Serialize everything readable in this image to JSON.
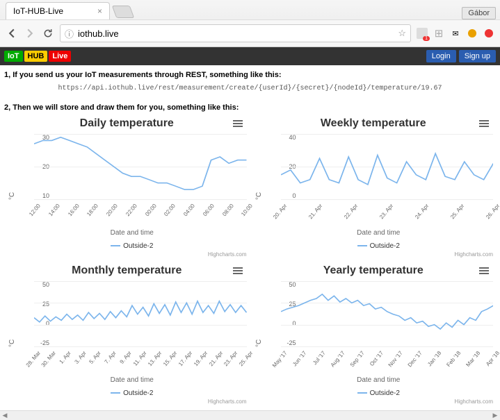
{
  "browser": {
    "tab_title": "IoT-HUB-Live",
    "profile": "Gábor",
    "url": "iothub.live"
  },
  "logo": {
    "iot": "IoT",
    "hub": "HUB",
    "live": "Live"
  },
  "auth": {
    "login": "Login",
    "signup": "Sign up"
  },
  "intro1": "1, If you send us your IoT measurements through REST, something like this:",
  "rest_url": "https://api.iothub.live/rest/measurement/create/{userId}/{secret}/{nodeId}/temperature/19.67",
  "intro2": "2, Then we will store and draw them for you, something like this:",
  "common": {
    "ylabel": "°C",
    "xlabel": "Date and time",
    "series_name": "Outside-2",
    "credit": "Highcharts.com"
  },
  "chart_data": [
    {
      "id": "daily",
      "type": "line",
      "title": "Daily temperature",
      "ylabel": "°C",
      "xlabel": "Date and time",
      "ylim": [
        10,
        30
      ],
      "y_ticks": [
        "30",
        "20",
        "10"
      ],
      "x_ticks": [
        "12:00",
        "14:00",
        "16:00",
        "18:00",
        "20:00",
        "22:00",
        "00:00",
        "02:00",
        "04:00",
        "06:00",
        "08:00",
        "10:00"
      ],
      "series": [
        {
          "name": "Outside-2",
          "values": [
            27,
            28,
            28,
            29,
            28,
            27,
            26,
            24,
            22,
            20,
            18,
            17,
            17,
            16,
            15,
            15,
            14,
            13,
            13,
            14,
            22,
            23,
            21,
            22,
            22
          ]
        }
      ]
    },
    {
      "id": "weekly",
      "type": "line",
      "title": "Weekly temperature",
      "ylabel": "°C",
      "xlabel": "Date and time",
      "ylim": [
        0,
        40
      ],
      "y_ticks": [
        "40",
        "20",
        "0"
      ],
      "x_ticks": [
        "20. Apr",
        "21. Apr",
        "22. Apr",
        "23. Apr",
        "24. Apr",
        "25. Apr",
        "26. Apr"
      ],
      "series": [
        {
          "name": "Outside-2",
          "values": [
            15,
            18,
            10,
            12,
            25,
            12,
            10,
            26,
            12,
            9,
            27,
            13,
            10,
            23,
            15,
            12,
            28,
            14,
            12,
            23,
            15,
            12,
            22
          ]
        }
      ]
    },
    {
      "id": "monthly",
      "type": "line",
      "title": "Monthly temperature",
      "ylabel": "°C",
      "xlabel": "Date and time",
      "ylim": [
        -25,
        50
      ],
      "y_ticks": [
        "50",
        "25",
        "0",
        "-25"
      ],
      "x_ticks": [
        "28. Mar",
        "30. Mar",
        "1. Apr",
        "3. Apr",
        "5. Apr",
        "7. Apr",
        "9. Apr",
        "11. Apr",
        "13. Apr",
        "15. Apr",
        "17. Apr",
        "19. Apr",
        "21. Apr",
        "23. Apr",
        "25. Apr"
      ],
      "series": [
        {
          "name": "Outside-2",
          "values": [
            8,
            3,
            10,
            4,
            9,
            5,
            12,
            6,
            11,
            5,
            14,
            7,
            13,
            6,
            15,
            8,
            16,
            9,
            22,
            12,
            20,
            10,
            24,
            13,
            23,
            11,
            26,
            14,
            25,
            12,
            27,
            14,
            22,
            13,
            27,
            15,
            23,
            14,
            22,
            14
          ]
        }
      ]
    },
    {
      "id": "yearly",
      "type": "line",
      "title": "Yearly temperature",
      "ylabel": "°C",
      "xlabel": "Date and time",
      "ylim": [
        -25,
        50
      ],
      "y_ticks": [
        "50",
        "25",
        "0",
        "-25"
      ],
      "x_ticks": [
        "May '17",
        "Jun '17",
        "Jul '17",
        "Aug '17",
        "Sep '17",
        "Oct '17",
        "Nov '17",
        "Dec '17",
        "Jan '18",
        "Feb '18",
        "Mar '18",
        "Apr '18"
      ],
      "series": [
        {
          "name": "Outside-2",
          "values": [
            15,
            18,
            20,
            22,
            25,
            28,
            30,
            35,
            28,
            33,
            26,
            30,
            25,
            28,
            22,
            24,
            18,
            20,
            15,
            12,
            10,
            5,
            8,
            2,
            4,
            -2,
            0,
            -5,
            2,
            -3,
            5,
            0,
            8,
            5,
            15,
            18,
            22
          ]
        }
      ]
    }
  ]
}
